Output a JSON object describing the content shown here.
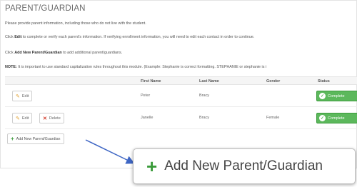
{
  "page": {
    "title": "PARENT/GUARDIAN",
    "intro": "Please provide parent information, including those who do not live with the student.",
    "line2_prefix": "Click ",
    "line2_bold": "Edit",
    "line2_rest": " to complete or verify each parent's information. If verifying enrollment information, you will need to edit each contact in order to continue.",
    "line3_prefix": "Click ",
    "line3_bold": "Add New Parent/Guardian",
    "line3_rest": " to add additional parent/guardians.",
    "note_bold": "NOTE:",
    "note_rest": " It is important to use standard capitalization rules throughout this module. (Example: Stephanie is correct formatting. STEPHANIE or stephanie is i"
  },
  "table": {
    "headers": [
      "First Name",
      "Last Name",
      "Gender",
      "Status"
    ],
    "rows": [
      {
        "edit": "Edit",
        "first": "Peter",
        "last": "Bracy",
        "gender": "",
        "status": "Complete"
      },
      {
        "edit": "Edit",
        "delete": "Delete",
        "first": "Janelle",
        "last": "Bracy",
        "gender": "Female",
        "status": "Complete"
      }
    ]
  },
  "actions": {
    "add_label": "Add New Parent/Guardian"
  },
  "colors": {
    "accent_green": "#5cb85c",
    "arrow_blue": "#3e66c4",
    "delete_red": "#d23a2a"
  }
}
